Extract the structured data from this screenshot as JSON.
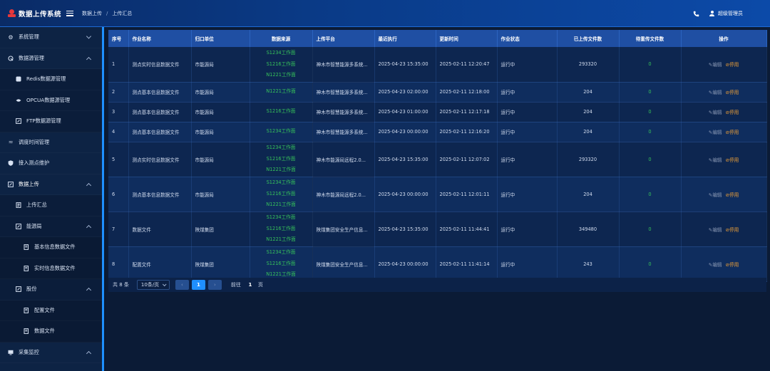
{
  "header": {
    "app_title": "数据上传系统",
    "breadcrumb": [
      "数据上传",
      "上传汇总"
    ],
    "user_name": "超级管理员"
  },
  "sidebar": {
    "items": [
      {
        "label": "系统管理",
        "icon": "gear-icon",
        "level": 0,
        "caret": "down"
      },
      {
        "label": "数据源管理",
        "icon": "database-icon",
        "level": 0,
        "caret": "up"
      },
      {
        "label": "Redis数据源管理",
        "icon": "redis-icon",
        "level": 1
      },
      {
        "label": "OPCUA数据源管理",
        "icon": "opcua-icon",
        "level": 1
      },
      {
        "label": "FTP数据源管理",
        "icon": "ftp-icon",
        "level": 1
      },
      {
        "label": "调度时间管理",
        "icon": "schedule-icon",
        "level": 0
      },
      {
        "label": "接入测点维护",
        "icon": "shield-icon",
        "level": 0
      },
      {
        "label": "数据上传",
        "icon": "upload-icon",
        "level": 0,
        "caret": "up"
      },
      {
        "label": "上传汇总",
        "icon": "list-icon",
        "level": 1
      },
      {
        "label": "能源局",
        "icon": "folder-icon",
        "level": 1,
        "caret": "up"
      },
      {
        "label": "基本信息数据文件",
        "icon": "file-icon",
        "level": 2
      },
      {
        "label": "实时信息数据文件",
        "icon": "file-icon",
        "level": 2
      },
      {
        "label": "股份",
        "icon": "folder-icon",
        "level": 1,
        "caret": "up"
      },
      {
        "label": "配置文件",
        "icon": "file-icon",
        "level": 2
      },
      {
        "label": "数据文件",
        "icon": "file-icon",
        "level": 2
      },
      {
        "label": "采集监控",
        "icon": "monitor-icon",
        "level": 0,
        "caret": "up"
      }
    ]
  },
  "table": {
    "columns": [
      "序号",
      "作业名称",
      "归口单位",
      "数据来源",
      "上传平台",
      "最近执行",
      "更新时间",
      "作业状态",
      "已上传文件数",
      "待重传文件数",
      "操作"
    ],
    "rows": [
      {
        "no": "1",
        "name": "测点实时信息数据文件",
        "unit": "市能源局",
        "sources": [
          "S1234工作面",
          "S1216工作面",
          "N1221工作面"
        ],
        "platform": "神木市智慧能源多系统...",
        "last_run": "2025-04-23 15:35:00",
        "updated": "2025-02-11 12:20:47",
        "status": "运行中",
        "uploaded": "293320",
        "pending": "0",
        "edit": "编辑",
        "stop": "停用"
      },
      {
        "no": "2",
        "name": "测点基本信息数据文件",
        "unit": "市能源局",
        "sources": [
          "N1221工作面"
        ],
        "platform": "神木市智慧能源多系统...",
        "last_run": "2025-04-23 02:00:00",
        "updated": "2025-02-11 12:18:00",
        "status": "运行中",
        "uploaded": "204",
        "pending": "0",
        "edit": "编辑",
        "stop": "停用"
      },
      {
        "no": "3",
        "name": "测点基本信息数据文件",
        "unit": "市能源局",
        "sources": [
          "S1216工作面"
        ],
        "platform": "神木市智慧能源多系统...",
        "last_run": "2025-04-23 01:00:00",
        "updated": "2025-02-11 12:17:18",
        "status": "运行中",
        "uploaded": "204",
        "pending": "0",
        "edit": "编辑",
        "stop": "停用"
      },
      {
        "no": "4",
        "name": "测点基本信息数据文件",
        "unit": "市能源局",
        "sources": [
          "S1234工作面"
        ],
        "platform": "神木市智慧能源多系统...",
        "last_run": "2025-04-23 00:00:00",
        "updated": "2025-02-11 12:16:20",
        "status": "运行中",
        "uploaded": "204",
        "pending": "0",
        "edit": "编辑",
        "stop": "停用"
      },
      {
        "no": "5",
        "name": "测点实时信息数据文件",
        "unit": "市能源局",
        "sources": [
          "S1234工作面",
          "S1216工作面",
          "N1221工作面"
        ],
        "platform": "神木市能源局远程2.0...",
        "last_run": "2025-04-23 15:35:00",
        "updated": "2025-02-11 12:07:02",
        "status": "运行中",
        "uploaded": "293320",
        "pending": "0",
        "edit": "编辑",
        "stop": "停用"
      },
      {
        "no": "6",
        "name": "测点基本信息数据文件",
        "unit": "市能源局",
        "sources": [
          "S1234工作面",
          "S1216工作面",
          "N1221工作面"
        ],
        "platform": "神木市能源局远程2.0...",
        "last_run": "2025-04-23 00:00:00",
        "updated": "2025-02-11 12:01:11",
        "status": "运行中",
        "uploaded": "204",
        "pending": "0",
        "edit": "编辑",
        "stop": "停用"
      },
      {
        "no": "7",
        "name": "数据文件",
        "unit": "陕煤集团",
        "sources": [
          "S1234工作面",
          "S1216工作面",
          "N1221工作面"
        ],
        "platform": "陕煤集团安全生产信息...",
        "last_run": "2025-04-23 15:35:00",
        "updated": "2025-02-11 11:44:41",
        "status": "运行中",
        "uploaded": "349480",
        "pending": "0",
        "edit": "编辑",
        "stop": "停用"
      },
      {
        "no": "8",
        "name": "配置文件",
        "unit": "陕煤集团",
        "sources": [
          "S1234工作面",
          "S1216工作面",
          "N1221工作面"
        ],
        "platform": "陕煤集团安全生产信息...",
        "last_run": "2025-04-23 00:00:00",
        "updated": "2025-02-11 11:41:14",
        "status": "运行中",
        "uploaded": "243",
        "pending": "0",
        "edit": "编辑",
        "stop": "停用"
      }
    ]
  },
  "pagination": {
    "total_text": "共 8 条",
    "page_size": "10条/页",
    "current_page": "1",
    "goto_label": "前往",
    "goto_value": "1",
    "page_unit": "页"
  },
  "colors": {
    "header_bg": "#0c4aa8",
    "table_header_bg": "#1f4fa3",
    "source_green": "#36c25a",
    "stop_orange": "#f0a137",
    "pager_active": "#1f8fff",
    "sidebar_accent": "#1e90ff"
  }
}
